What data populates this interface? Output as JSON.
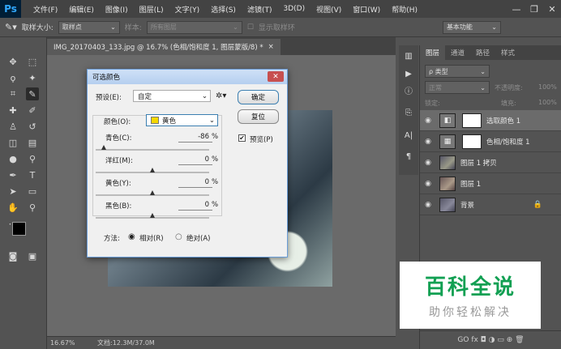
{
  "menu": {
    "logo": "Ps",
    "items": [
      "文件(F)",
      "编辑(E)",
      "图像(I)",
      "图层(L)",
      "文字(Y)",
      "选择(S)",
      "滤镜(T)",
      "3D(D)",
      "视图(V)",
      "窗口(W)",
      "帮助(H)"
    ]
  },
  "window_controls": {
    "minimize": "—",
    "restore": "❐",
    "close": "✕"
  },
  "options": {
    "sample_size_label": "取样大小:",
    "sample_size_value": "取样点",
    "sample_label": "样本:",
    "sample_value": "所有图层",
    "show_ring": "显示取样环",
    "workspace": "基本功能"
  },
  "doc_tab": {
    "title": "IMG_20170403_133.jpg @ 16.7% (色相/饱和度 1, 图层蒙版/8) *",
    "close": "×"
  },
  "status": {
    "zoom": "16.67%",
    "doc_info": "文档:12.3M/37.0M"
  },
  "dialog": {
    "title": "可选颜色",
    "close": "✕",
    "preset_label": "预设(E):",
    "preset_value": "自定",
    "colors_label": "颜色(O):",
    "colors_value": "黄色",
    "colors_swatch": "#f5d800",
    "ok": "确定",
    "reset": "复位",
    "preview": "预览(P)",
    "sliders": [
      {
        "label": "青色(C):",
        "value": "-86",
        "pct": "%",
        "level": -86
      },
      {
        "label": "洋红(M):",
        "value": "0",
        "pct": "%",
        "level": 0
      },
      {
        "label": "黄色(Y):",
        "value": "0",
        "pct": "%",
        "level": 0
      },
      {
        "label": "黑色(B):",
        "value": "0",
        "pct": "%",
        "level": 0
      }
    ],
    "method_label": "方法:",
    "relative": "相对(R)",
    "absolute": "绝对(A)"
  },
  "panels": {
    "tabs": [
      "图层",
      "通道",
      "路径",
      "样式"
    ],
    "filter_label": "ρ 类型",
    "blend_mode": "正常",
    "opacity_label": "不透明度:",
    "opacity": "100%",
    "lock_label": "锁定:",
    "fill_label": "填充:",
    "fill": "100%",
    "layers": [
      {
        "name": "选取颜色 1"
      },
      {
        "name": "色相/饱和度 1"
      },
      {
        "name": "图层 1 拷贝"
      },
      {
        "name": "图层 1"
      },
      {
        "name": "背景"
      }
    ],
    "bottom_icons": "GO fx ◘ ◑ ▭ ⊕ 🗑"
  },
  "watermark": {
    "title": "百科全说",
    "subtitle": "助你轻松解决"
  }
}
